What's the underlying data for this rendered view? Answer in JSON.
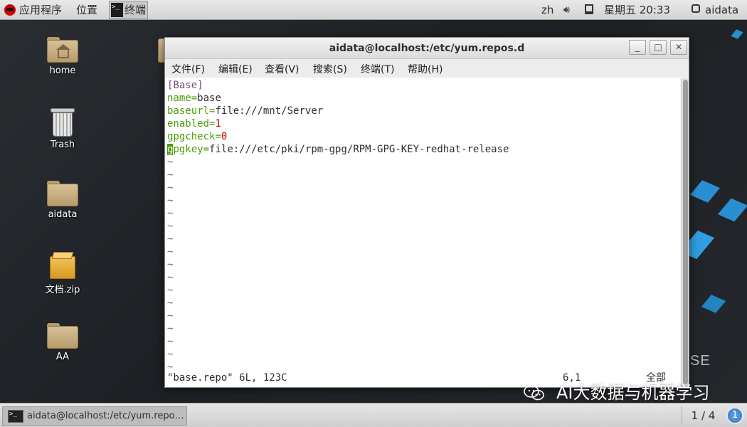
{
  "top_bar": {
    "applications": "应用程序",
    "places": "位置",
    "terminal_task": "终端",
    "input_method": "zh",
    "datetime": "星期五 20:33",
    "user": "aidata"
  },
  "desktop": {
    "icons": [
      {
        "label": "home"
      },
      {
        "label": "Trash"
      },
      {
        "label": "aidata"
      },
      {
        "label": "文档.zip"
      },
      {
        "label": "AA"
      }
    ],
    "partial_text": "SE"
  },
  "window": {
    "title": "aidata@localhost:/etc/yum.repos.d",
    "minimize": "_",
    "maximize": "□",
    "close": "✕",
    "menu": [
      "文件(F)",
      "编辑(E)",
      "查看(V)",
      "搜索(S)",
      "终端(T)",
      "帮助(H)"
    ]
  },
  "vim": {
    "lines": [
      {
        "section": "[Base]"
      },
      {
        "key": "name",
        "value": "base"
      },
      {
        "key": "baseurl",
        "value": "file:///mnt/Server"
      },
      {
        "key": "enabled",
        "value": "1"
      },
      {
        "key": "gpgcheck",
        "value": "0"
      },
      {
        "cursor_char": "g",
        "key_rest": "pgkey",
        "value": "file:///etc/pki/rpm-gpg/RPM-GPG-KEY-redhat-release"
      }
    ],
    "tilde": "~",
    "status_file": "\"base.repo\" 6L, 123C",
    "status_pos": "6,1",
    "status_scroll": "全部"
  },
  "watermark": "AI大数据与机器学习",
  "bottom_panel": {
    "task_label": "aidata@localhost:/etc/yum.repo…",
    "workspace": "1 / 4",
    "notification_count": "1"
  },
  "colors": {
    "vim_key": "#4e9a06",
    "vim_number": "#cc0000",
    "vim_section": "#75507b"
  }
}
